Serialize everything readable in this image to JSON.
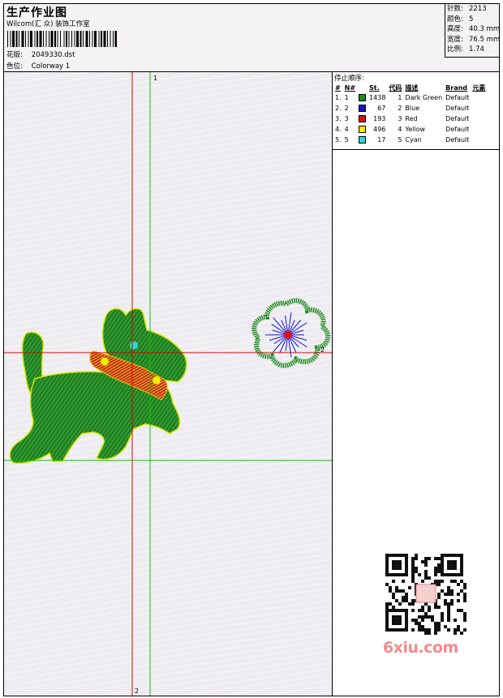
{
  "header": {
    "title": "生产作业图",
    "company": "Wilcom(汇 众) 装饰工作室",
    "design_label": "花版:",
    "design_value": "2049330.dst",
    "colorway_label": "色位:",
    "colorway_value": "Colorway 1"
  },
  "stats": [
    {
      "label": "针数:",
      "value": "2213"
    },
    {
      "label": "颜色:",
      "value": "5"
    },
    {
      "label": "高度:",
      "value": "40.3 mm"
    },
    {
      "label": "宽度:",
      "value": "76.5 mm"
    },
    {
      "label": "比例:",
      "value": "1.74"
    }
  ],
  "stop_sequence": {
    "title": "停止顺序:",
    "columns": [
      "#",
      "N#",
      "St.",
      "代码",
      "描述",
      "Brand",
      "元素"
    ],
    "rows": [
      {
        "idx": "1.",
        "n": "1",
        "color": "#1f8a1f",
        "st": "1438",
        "code": "1",
        "desc": "Dark Green",
        "brand": "Default"
      },
      {
        "idx": "2.",
        "n": "2",
        "color": "#1010e0",
        "st": "67",
        "code": "2",
        "desc": "Blue",
        "brand": "Default"
      },
      {
        "idx": "3.",
        "n": "3",
        "color": "#e01010",
        "st": "193",
        "code": "3",
        "desc": "Red",
        "brand": "Default"
      },
      {
        "idx": "4.",
        "n": "4",
        "color": "#f0f000",
        "st": "496",
        "code": "4",
        "desc": "Yellow",
        "brand": "Default"
      },
      {
        "idx": "5.",
        "n": "5",
        "color": "#30d8d8",
        "st": "17",
        "code": "5",
        "desc": "Cyan",
        "brand": "Default"
      }
    ]
  },
  "canvas": {
    "guide_labels": {
      "v1": "1",
      "v2": "2",
      "h1": "2",
      "h2": "1"
    }
  },
  "watermark": "6xiu.com",
  "colors": {
    "green": "#1f8a1f",
    "blue": "#1010e0",
    "red": "#e01010",
    "yellow": "#f0f000",
    "cyan": "#30d8d8"
  }
}
